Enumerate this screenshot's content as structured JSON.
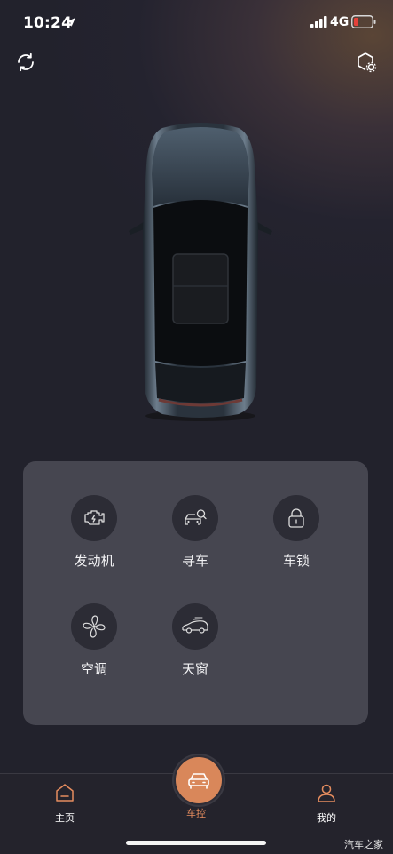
{
  "status_bar": {
    "time": "10:24",
    "network": "4G"
  },
  "header": {
    "left_icon": "refresh-icon",
    "right_icon": "settings-icon"
  },
  "vehicle_image": "car-top-view",
  "controls": [
    {
      "label": "发动机",
      "icon": "engine-icon"
    },
    {
      "label": "寻车",
      "icon": "find-car-icon"
    },
    {
      "label": "车锁",
      "icon": "lock-icon"
    },
    {
      "label": "空调",
      "icon": "fan-icon"
    },
    {
      "label": "天窗",
      "icon": "sunroof-icon"
    }
  ],
  "tabbar": {
    "items": [
      {
        "label": "主页",
        "icon": "home-icon"
      },
      {
        "label": "车控",
        "icon": "car-icon"
      },
      {
        "label": "我的",
        "icon": "person-icon"
      }
    ],
    "active": "车控"
  },
  "watermark": "汽车之家",
  "colors": {
    "accent": "#e58c5e",
    "panel": "#464650",
    "background": "#24232f",
    "battery_low": "#e5423a"
  }
}
